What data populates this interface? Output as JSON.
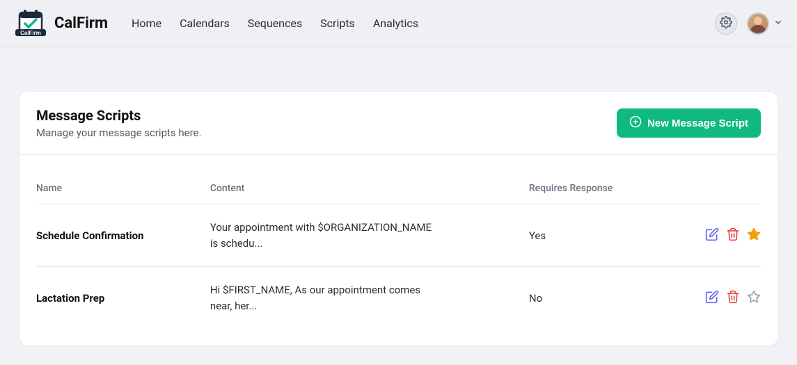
{
  "brand": "CalFirm",
  "nav": {
    "home": "Home",
    "calendars": "Calendars",
    "sequences": "Sequences",
    "scripts": "Scripts",
    "analytics": "Analytics"
  },
  "page": {
    "title": "Message Scripts",
    "subtitle": "Manage your message scripts here.",
    "new_button": "New Message Script"
  },
  "table": {
    "cols": {
      "name": "Name",
      "content": "Content",
      "response": "Requires Response"
    },
    "rows": [
      {
        "name": "Schedule Confirmation",
        "content": "Your appointment with $ORGANIZATION_NAME is schedu...",
        "response": "Yes",
        "starred": true
      },
      {
        "name": "Lactation Prep",
        "content": "Hi $FIRST_NAME, As our appointment comes near, her...",
        "response": "No",
        "starred": false
      }
    ]
  }
}
